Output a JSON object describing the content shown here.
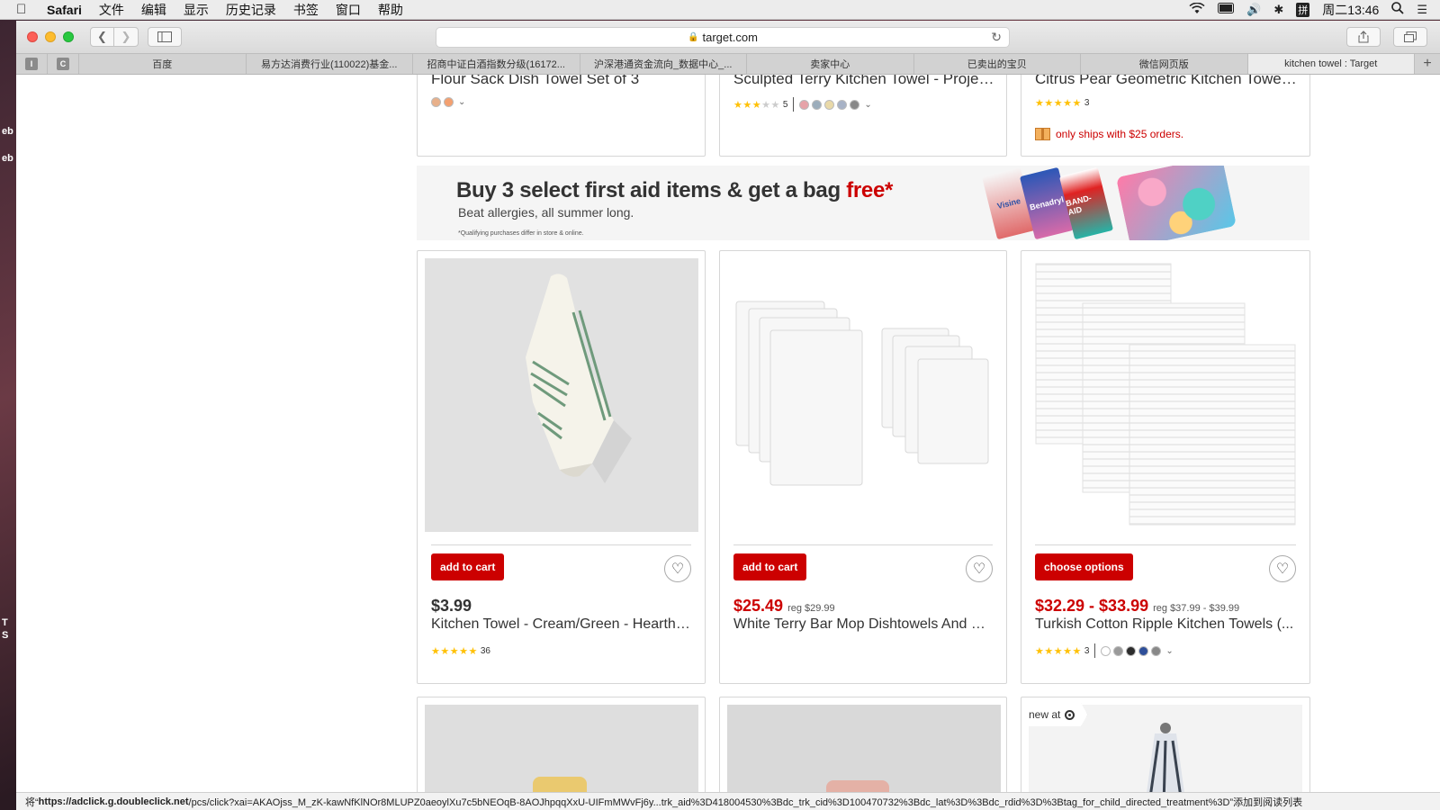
{
  "menubar": {
    "app_name": "Safari",
    "items": [
      "文件",
      "编辑",
      "显示",
      "历史记录",
      "书签",
      "窗口",
      "帮助"
    ],
    "clock": "周二13:46",
    "input_method": "拼"
  },
  "browser": {
    "url": "target.com",
    "pinned": [
      "I",
      "C"
    ],
    "tabs": [
      {
        "label": "百度"
      },
      {
        "label": "易方达消费行业(110022)基金..."
      },
      {
        "label": "招商中证白酒指数分级(16172..."
      },
      {
        "label": "沪深港通资金流向_数据中心_..."
      },
      {
        "label": "卖家中心"
      },
      {
        "label": "已卖出的宝贝"
      },
      {
        "label": "微信网页版"
      },
      {
        "label": "kitchen towel : Target"
      }
    ],
    "status_prefix": "将“",
    "status_url": "https://adclick.g.doubleclick.net",
    "status_rest": "/pcs/click?xai=AKAOjss_M_zK-kawNfKlNOr8MLUPZ0aeoylXu7c5bNEOqB-8AOJhpqqXxU-UIFmMWvFj6y...trk_aid%3D418004530%3Bdc_trk_cid%3D100470732%3Bdc_lat%3D%3Bdc_rdid%3D%3Btag_for_child_directed_treatment%3D”添加到阅读列表"
  },
  "top_row": [
    {
      "title": "Flour Sack Dish Towel Set of 3",
      "swatch_colors": [
        "#e8b08a",
        "#f3a070"
      ]
    },
    {
      "title": "Sculpted Terry Kitchen Towel - Project ...",
      "rating": 3,
      "count": "5",
      "swatch_colors": [
        "#e6a3a8",
        "#9cadbb",
        "#e9d9a8",
        "#a7b2c6",
        "#888888"
      ]
    },
    {
      "title": "Citrus Pear Geometric Kitchen Towel - ...",
      "rating": 5,
      "count": "3",
      "shipping_note": "only ships with $25 orders."
    }
  ],
  "promo": {
    "headline_main": "Buy 3 select first aid items & get a bag ",
    "headline_accent": "free*",
    "subline": "Beat allergies, all summer long.",
    "fine_print": "*Qualifying purchases differ in store & online.",
    "pack_labels": [
      "Visine",
      "Benadryl",
      "BAND-AID"
    ]
  },
  "products": [
    {
      "button": "add to cart",
      "price": "$3.99",
      "sale": false,
      "reg": "",
      "name": "Kitchen Towel - Cream/Green - Hearth & Hand with Magnolia",
      "rating": 5,
      "count": "36"
    },
    {
      "button": "add to cart",
      "price": "$25.49",
      "sale": true,
      "reg": "reg $29.99",
      "name": "White Terry Bar Mop Dishtowels And Dishcloths"
    },
    {
      "button": "choose options",
      "price": "$32.29 - $33.99",
      "sale": true,
      "reg": "reg $37.99 - $39.99",
      "name": "Turkish Cotton Ripple Kitchen Towels (...",
      "rating": 5,
      "count": "3",
      "swatch_colors": [
        "#ffffff",
        "#9a9a9a",
        "#2c2c2c",
        "#2e4f99",
        "#888888"
      ]
    }
  ],
  "bottom_row": {
    "badge": "new at"
  },
  "colors": {
    "brand_red": "#cc0000",
    "star": "#ffc107"
  }
}
